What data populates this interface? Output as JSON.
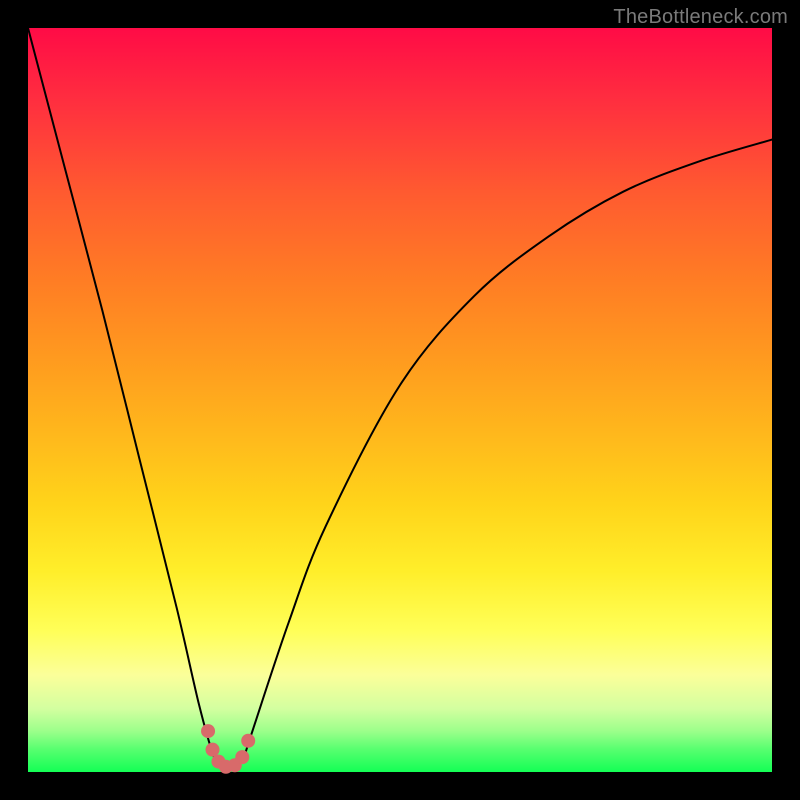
{
  "watermark": "TheBottleneck.com",
  "chart_data": {
    "type": "line",
    "title": "",
    "xlabel": "",
    "ylabel": "",
    "xlim": [
      0,
      100
    ],
    "ylim": [
      0,
      100
    ],
    "grid": false,
    "legend": false,
    "series": [
      {
        "name": "bottleneck-curve",
        "x": [
          0,
          5,
          10,
          15,
          20,
          23,
          25,
          26,
          27,
          28,
          29,
          30,
          35,
          40,
          50,
          60,
          70,
          80,
          90,
          100
        ],
        "y": [
          100,
          81,
          62,
          42,
          22,
          9,
          2,
          0.7,
          0.4,
          0.7,
          2,
          5,
          20,
          33,
          52,
          64,
          72,
          78,
          82,
          85
        ]
      }
    ],
    "annotations": [
      {
        "type": "dots",
        "name": "minimum-cluster",
        "points": [
          {
            "x": 24.2,
            "y": 5.5
          },
          {
            "x": 24.8,
            "y": 3.0
          },
          {
            "x": 25.6,
            "y": 1.4
          },
          {
            "x": 26.6,
            "y": 0.7
          },
          {
            "x": 27.8,
            "y": 0.9
          },
          {
            "x": 28.8,
            "y": 2.0
          },
          {
            "x": 29.6,
            "y": 4.2
          }
        ]
      }
    ],
    "background_gradient": {
      "top": "#ff0b46",
      "bottom": "#13ff55"
    }
  }
}
